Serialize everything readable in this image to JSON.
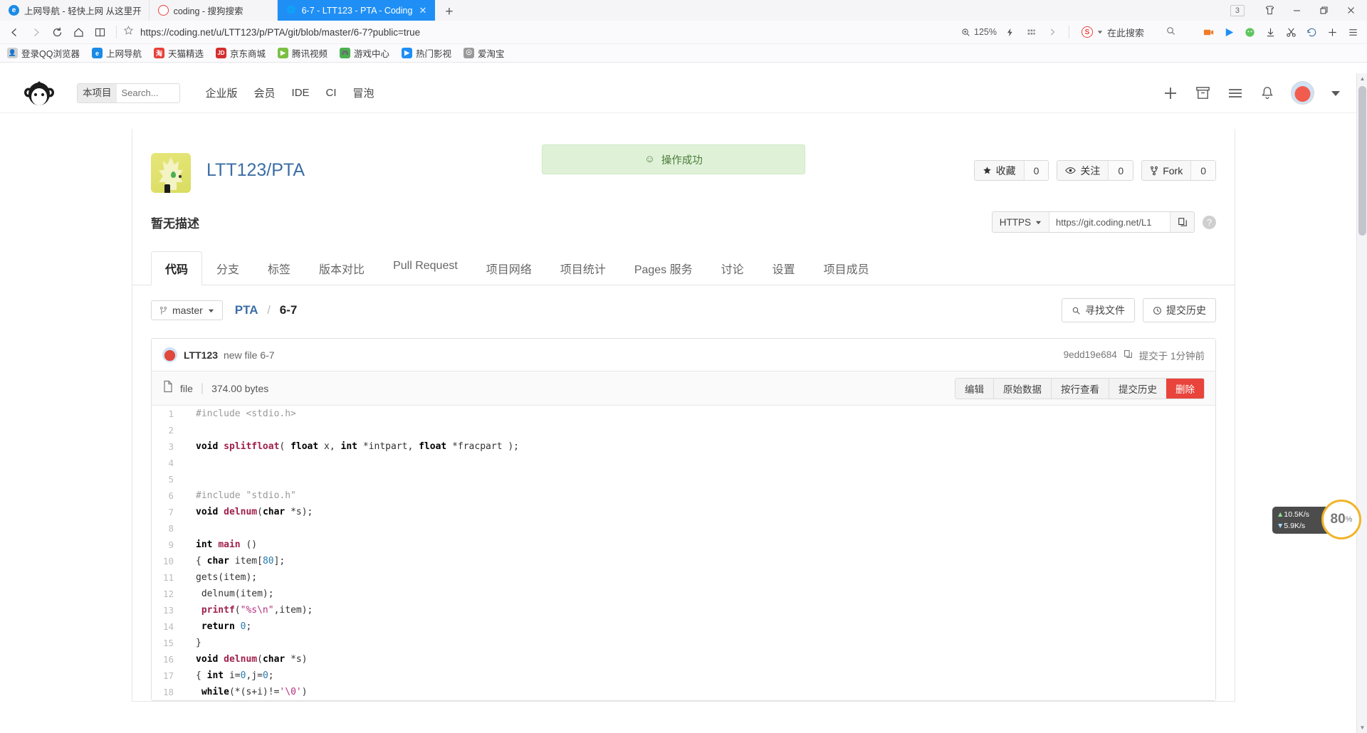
{
  "browser": {
    "tabs": [
      {
        "title": "上网导航 - 轻快上网 从这里开",
        "favicon": "e-icon",
        "active": false
      },
      {
        "title": "coding - 搜狗搜索",
        "favicon": "sogou-icon",
        "active": false
      },
      {
        "title": "6-7 - LTT123 - PTA - Coding",
        "favicon": "globe-icon",
        "active": true
      }
    ],
    "new_tab_label": "+",
    "window": {
      "tab_count_badge": "3",
      "skin_icon": "tshirt-icon",
      "minimize": "–",
      "maximize": "❐",
      "close": "✕"
    },
    "toolbar": {
      "back": "back-icon",
      "forward": "forward-icon",
      "reload": "reload-icon",
      "home": "home-icon",
      "reader": "reader-icon",
      "bookmark_star": "star-icon",
      "url": "https://coding.net/u/LTT123/p/PTA/git/blob/master/6-7?public=true",
      "zoom_level": "125%",
      "lightning_icon": "lightning-icon",
      "apps_icon": "apps-grid-icon",
      "chevron_icon": "chevron-right-icon",
      "search_engine": "sogou-icon",
      "search_placeholder": "在此搜索",
      "search_icon": "search-icon",
      "icons": [
        "video-icon",
        "player-icon",
        "wechat-icon",
        "download-icon",
        "scissors-icon",
        "history-icon",
        "add-icon",
        "menu-icon"
      ]
    },
    "bookmarks": [
      {
        "label": "登录QQ浏览器",
        "icon": "user-icon",
        "color": "#c8c8c8"
      },
      {
        "label": "上网导航",
        "icon": "e-icon",
        "color": "#1b8ae5"
      },
      {
        "label": "天猫精选",
        "icon": "tmall-icon",
        "color": "#e8413a"
      },
      {
        "label": "京东商城",
        "icon": "jd-icon",
        "color": "#d32f2f"
      },
      {
        "label": "腾讯视频",
        "icon": "play-icon",
        "color": "#7bc043"
      },
      {
        "label": "游戏中心",
        "icon": "game-icon",
        "color": "#4caf50"
      },
      {
        "label": "热门影视",
        "icon": "play2-icon",
        "color": "#1f8ff5"
      },
      {
        "label": "爱淘宝",
        "icon": "globe-icon",
        "color": "#9a9a9a"
      }
    ]
  },
  "site_header": {
    "logo": "coding-monkey-logo",
    "search_scope": "本项目",
    "search_placeholder": "Search...",
    "search_value": "",
    "nav": [
      "企业版",
      "会员",
      "IDE",
      "CI",
      "冒泡"
    ],
    "right_icons": [
      "plus-icon",
      "archive-icon",
      "list-icon",
      "bell-icon"
    ],
    "avatar": "user-avatar",
    "chevron": "chevron-down-icon"
  },
  "toast": {
    "icon": "smiley-icon",
    "message": "操作成功"
  },
  "repo": {
    "full_name": "LTT123/PTA",
    "avatar": "repo-avatar",
    "actions": [
      {
        "icon": "star-icon",
        "label": "收藏",
        "count": "0"
      },
      {
        "icon": "eye-icon",
        "label": "关注",
        "count": "0"
      },
      {
        "icon": "fork-icon",
        "label": "Fork",
        "count": "0"
      }
    ],
    "description": "暂无描述",
    "clone": {
      "protocol": "HTTPS",
      "chevron": "chevron-down-icon",
      "url": "https://git.coding.net/L1",
      "copy_icon": "copy-icon",
      "help_icon": "question-icon"
    },
    "tabs": [
      {
        "label": "代码",
        "active": true
      },
      {
        "label": "分支",
        "active": false
      },
      {
        "label": "标签",
        "active": false
      },
      {
        "label": "版本对比",
        "active": false
      },
      {
        "label": "Pull Request",
        "active": false
      },
      {
        "label": "项目网络",
        "active": false
      },
      {
        "label": "项目统计",
        "active": false
      },
      {
        "label": "Pages 服务",
        "active": false
      },
      {
        "label": "讨论",
        "active": false
      },
      {
        "label": "设置",
        "active": false
      },
      {
        "label": "项目成员",
        "active": false
      }
    ]
  },
  "path_bar": {
    "branch_icon": "branch-icon",
    "branch": "master",
    "branch_chevron": "chevron-down-icon",
    "crumb_root": "PTA",
    "crumb_sep": "/",
    "crumb_file": "6-7",
    "find_file": {
      "icon": "search-icon",
      "label": "寻找文件"
    },
    "history": {
      "icon": "clock-icon",
      "label": "提交历史"
    }
  },
  "commit": {
    "avatar": "user-avatar",
    "author": "LTT123",
    "message": "new file 6-7",
    "hash": "9edd19e684",
    "copy_icon": "copy-icon",
    "time": "提交于 1分钟前"
  },
  "file": {
    "icon": "file-icon",
    "name": "file",
    "size": "374.00 bytes",
    "actions": [
      {
        "label": "编辑",
        "danger": false
      },
      {
        "label": "原始数据",
        "danger": false
      },
      {
        "label": "按行查看",
        "danger": false
      },
      {
        "label": "提交历史",
        "danger": false
      },
      {
        "label": "删除",
        "danger": true
      }
    ]
  },
  "code_lines": [
    {
      "n": "1",
      "html": "<span class='cmt'>#include &lt;stdio.h&gt;</span>"
    },
    {
      "n": "2",
      "html": ""
    },
    {
      "n": "3",
      "html": "<span class='k'>void</span> <span class='fn'>splitfloat</span>( <span class='k'>float</span> x, <span class='k'>int</span> *intpart, <span class='k'>float</span> *fracpart );"
    },
    {
      "n": "4",
      "html": ""
    },
    {
      "n": "5",
      "html": ""
    },
    {
      "n": "6",
      "html": "<span class='cmt'>#include \"stdio.h\"</span>"
    },
    {
      "n": "7",
      "html": "<span class='k'>void</span> <span class='fn'>delnum</span>(<span class='k'>char</span> *s);"
    },
    {
      "n": "8",
      "html": ""
    },
    {
      "n": "9",
      "html": "<span class='k'>int</span> <span class='fn'>main</span> ()"
    },
    {
      "n": "10",
      "html": "{ <span class='k'>char</span> item[<span class='num'>80</span>];"
    },
    {
      "n": "11",
      "html": "gets(item);"
    },
    {
      "n": "12",
      "html": " delnum(item);"
    },
    {
      "n": "13",
      "html": " <span class='fn'>printf</span>(<span class='str'>\"%s\\n\"</span>,item);"
    },
    {
      "n": "14",
      "html": " <span class='k'>return</span> <span class='num'>0</span>;"
    },
    {
      "n": "15",
      "html": "}"
    },
    {
      "n": "16",
      "html": "<span class='k'>void</span> <span class='fn'>delnum</span>(<span class='k'>char</span> *s)"
    },
    {
      "n": "17",
      "html": "{ <span class='k'>int</span> i=<span class='num'>0</span>,j=<span class='num'>0</span>;"
    },
    {
      "n": "18",
      "html": " <span class='k'>while</span>(*(s+i)!=<span class='str'>'\\0'</span>)"
    }
  ],
  "widgets": {
    "netspeed": {
      "up": "10.5K/s",
      "down": "5.9K/s"
    },
    "speedball": {
      "value": "80",
      "unit": "%"
    }
  }
}
